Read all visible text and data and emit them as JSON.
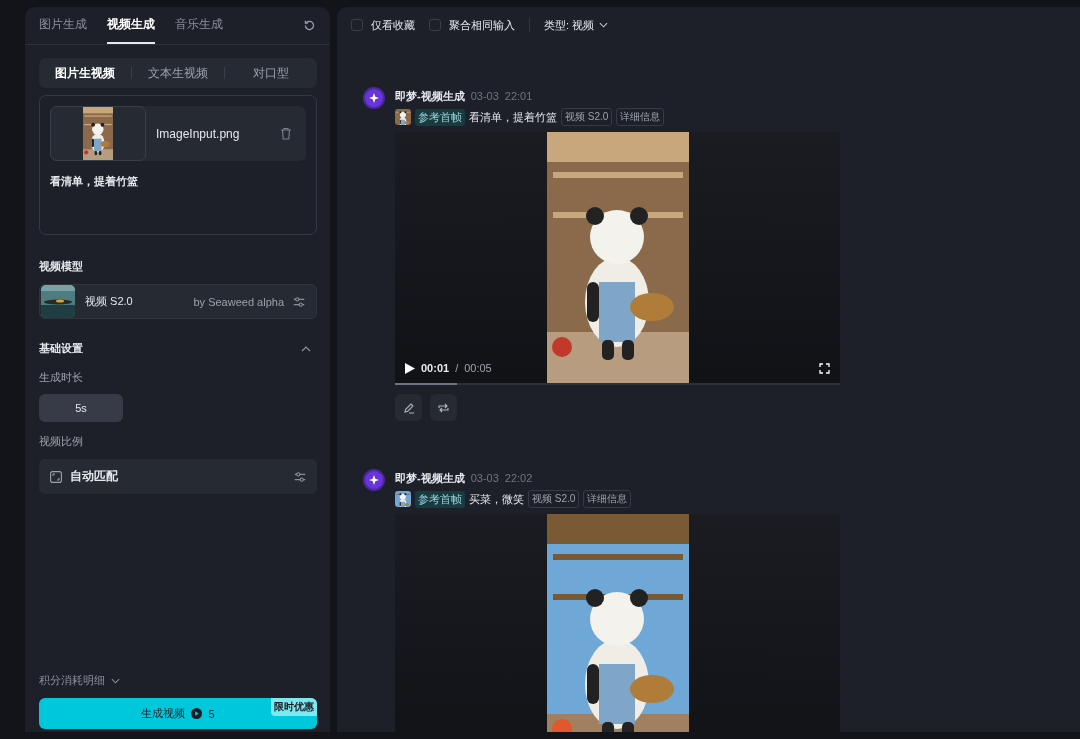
{
  "left_tabs": [
    {
      "label": "图片生成",
      "selected": false
    },
    {
      "label": "视频生成",
      "selected": true
    },
    {
      "label": "音乐生成",
      "selected": false
    }
  ],
  "mode_tabs": [
    {
      "label": "图片生视频",
      "selected": true
    },
    {
      "label": "文本生视频",
      "selected": false
    },
    {
      "label": "对口型",
      "selected": false
    }
  ],
  "image_input": {
    "kind": "picture",
    "filename": "ImageInput.png"
  },
  "prompt": {
    "value": "看清单，提着竹篮"
  },
  "model": {
    "label": "视频模型",
    "name": "视频 S2.0",
    "provider": "by Seaweed alpha"
  },
  "basic_settings": {
    "label": "基础设置",
    "expanded": true
  },
  "duration": {
    "label": "生成时长",
    "value": "5s"
  },
  "ratio": {
    "label": "视频比例",
    "value": "自动匹配"
  },
  "credits_link": "积分消耗明细",
  "generate_button": {
    "label": "生成视频",
    "cost": "5",
    "badge": "限时优惠"
  },
  "toolbar": {
    "filters": [
      {
        "label": "仅看收藏",
        "checked": false
      },
      {
        "label": "聚合相同输入",
        "checked": false
      }
    ],
    "type_filter": "类型: 视频"
  },
  "results": [
    {
      "author": "即梦-视频生成",
      "date": "03-03",
      "time": "22:01",
      "ref_label": "参考首帧",
      "prompt": "看清单，提着竹篮",
      "tags": [
        "视频 S2.0",
        "详细信息"
      ],
      "player": {
        "current": "00:01",
        "separator": "/",
        "total": "00:05",
        "level": 0.14
      }
    },
    {
      "author": "即梦-视频生成",
      "date": "03-03",
      "time": "22:02",
      "ref_label": "参考首帧",
      "prompt": "买菜，微笑",
      "tags": [
        "视频 S2.0",
        "详细信息"
      ]
    }
  ]
}
